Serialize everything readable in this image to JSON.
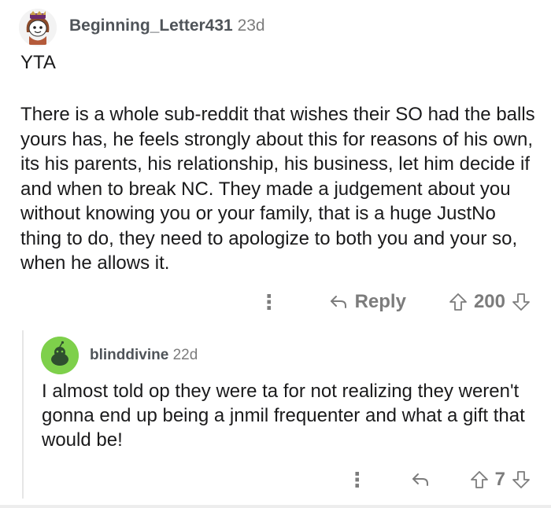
{
  "comments": [
    {
      "username": "Beginning_Letter431",
      "age": "23d",
      "tag": "YTA",
      "body": "There is a whole sub-reddit that wishes their SO had the balls yours has, he feels strongly about this for reasons of his own, its his parents, his relationship, his business, let him decide if and when to break NC. They made a judgement about you without knowing you or your family, that is a huge JustNo thing to do, they need to apologize to both you and your so, when he allows it.",
      "reply_label": "Reply",
      "score": "200",
      "more_icon": "more-options-icon",
      "reply_icon": "reply-arrow-icon",
      "upvote_icon": "upvote-arrow-icon",
      "downvote_icon": "downvote-arrow-icon"
    },
    {
      "username": "blinddivine",
      "age": "22d",
      "body": "I almost told op they were ta for not realizing they weren't gonna end up being a jnmil frequenter and what a gift that would be!",
      "score": "7",
      "more_icon": "more-options-icon",
      "reply_icon": "reply-arrow-icon",
      "upvote_icon": "upvote-arrow-icon",
      "downvote_icon": "downvote-arrow-icon"
    }
  ]
}
